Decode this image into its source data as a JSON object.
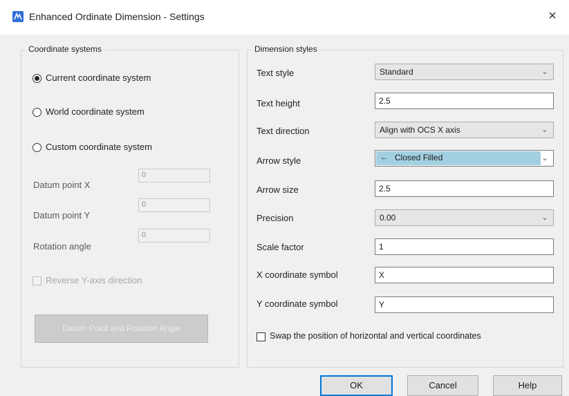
{
  "window": {
    "title": "Enhanced Ordinate Dimension - Settings",
    "app_icon": "app-logo-icon",
    "close_glyph": "×"
  },
  "coordinate_systems": {
    "legend": "Coordinate systems",
    "options": [
      {
        "label": "Current coordinate system",
        "checked": true
      },
      {
        "label": "World coordinate system",
        "checked": false
      },
      {
        "label": "Custom coordinate system",
        "checked": false
      }
    ],
    "datum_x": {
      "label": "Datum point X",
      "value": "0"
    },
    "datum_y": {
      "label": "Datum point Y",
      "value": "0"
    },
    "rotation": {
      "label": "Rotation angle",
      "value": "0"
    },
    "reverse_y": {
      "label": "Reverse Y-axis direction",
      "checked": false,
      "enabled": false
    },
    "datum_button": {
      "label": "Datum Point and Rotation Angle",
      "enabled": false
    }
  },
  "dimension_styles": {
    "legend": "Dimension styles",
    "text_style": {
      "label": "Text style",
      "value": "Standard"
    },
    "text_height": {
      "label": "Text height",
      "value": "2.5"
    },
    "text_direction": {
      "label": "Text direction",
      "value": "Align with OCS X axis"
    },
    "arrow_style": {
      "label": "Arrow style",
      "value": "Closed Filled",
      "glyph": "←"
    },
    "arrow_size": {
      "label": "Arrow size",
      "value": "2.5"
    },
    "precision": {
      "label": "Precision",
      "value": "0.00"
    },
    "scale_factor": {
      "label": "Scale factor",
      "value": "1"
    },
    "x_symbol": {
      "label": "X coordinate symbol",
      "value": "X"
    },
    "y_symbol": {
      "label": "Y coordinate symbol",
      "value": "Y"
    },
    "swap": {
      "label": "Swap the position of horizontal and vertical coordinates",
      "checked": false
    }
  },
  "buttons": {
    "ok": "OK",
    "cancel": "Cancel",
    "help": "Help"
  },
  "colors": {
    "selection_highlight": "#a3d0e0",
    "default_button_border": "#0078d7",
    "app_icon": "#2f6fd6"
  }
}
